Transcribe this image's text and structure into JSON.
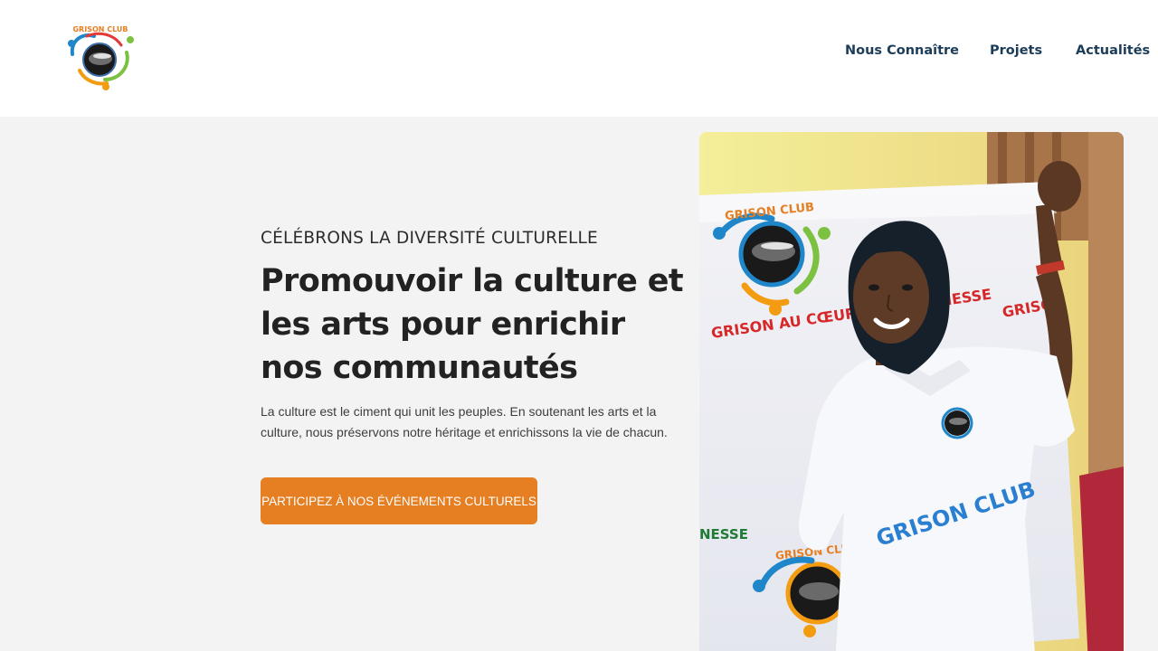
{
  "brand": {
    "logo_alt": "Grison Club logo",
    "logo_text": "GRISON CLUB",
    "colors": {
      "blue": "#1f86c9",
      "orange": "#f39c12",
      "green": "#7cc142",
      "red": "#e53935"
    }
  },
  "nav": {
    "items": [
      {
        "label": "Nous Connaître"
      },
      {
        "label": "Projets"
      },
      {
        "label": "Actualités"
      }
    ],
    "color": "#1c3d5a"
  },
  "hero": {
    "eyebrow": "CÉLÉBRONS LA DIVERSITÉ CULTURELLE",
    "headline": "Promouvoir la culture et les arts pour enrichir nos communautés",
    "body": "La culture est le ciment qui unit les peuples. En soutenant les arts et la culture, nous préservons notre héritage et enrichissons la vie de chacun.",
    "cta_label": "PARTICIPEZ À NOS ÉVÉNEMENTS CULTURELS",
    "cta_color": "#e67e22",
    "background": "#f3f3f3"
  },
  "photo": {
    "alt": "Young woman wearing a Grison Club t-shirt in front of a Grison Club banner",
    "banner_text_1": "GRISON CLUB",
    "banner_text_2": "GRISON AU CŒUR DE LA JEUNESSE",
    "banner_text_3": "GRISON CLUB",
    "shirt_text": "GRISON CLUB",
    "banner_side_text": "NESSE",
    "banner_right_text": "GRISO"
  }
}
